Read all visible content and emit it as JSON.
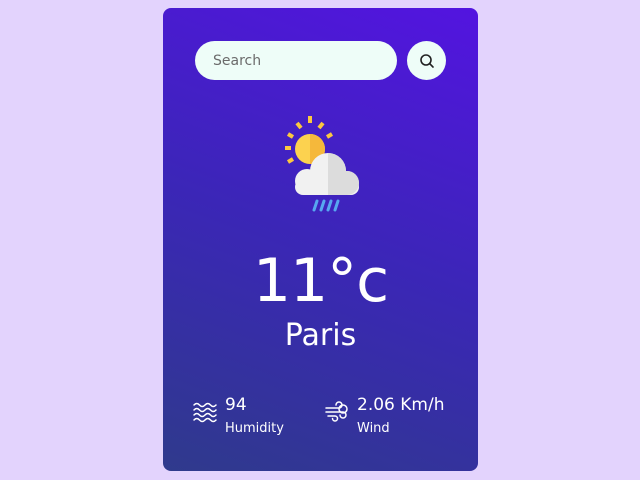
{
  "search": {
    "placeholder": "Search",
    "value": "",
    "button_icon": "search-icon"
  },
  "weather": {
    "icon": "sun-cloud-rain-icon",
    "temperature": "11°c",
    "city": "Paris"
  },
  "details": {
    "humidity": {
      "icon": "humidity-waves-icon",
      "value": "94",
      "label": "Humidity"
    },
    "wind": {
      "icon": "wind-icon",
      "value": "2.06 Km/h",
      "label": "Wind"
    }
  },
  "colors": {
    "page_background": "#e3d3fd",
    "card_gradient_top": "#5314e0",
    "card_gradient_bottom": "#2f3a8c",
    "search_background": "#eefdf8",
    "sun": "#fbc840",
    "cloud": "#e8e8e8",
    "rain": "#57a7f0"
  }
}
